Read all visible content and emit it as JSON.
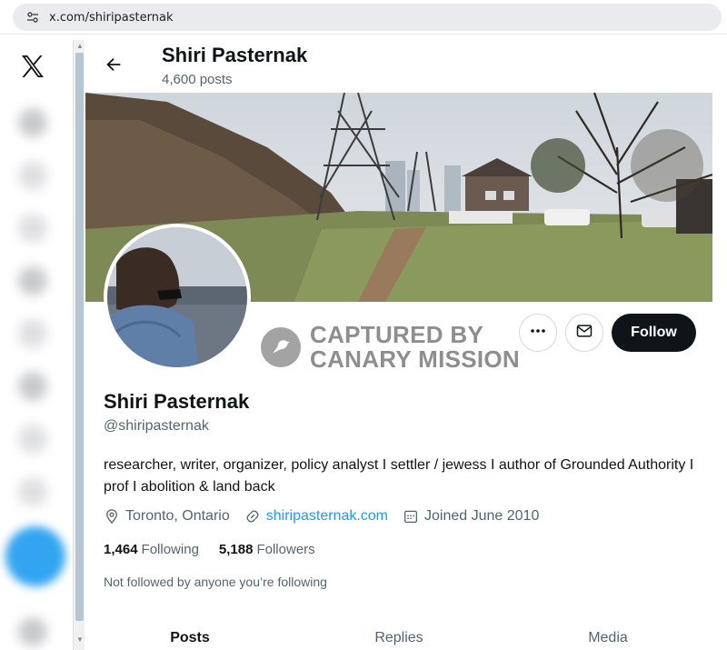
{
  "browser": {
    "url": "x.com/shiripasternak"
  },
  "header": {
    "name": "Shiri Pasternak",
    "posts_count": "4,600 posts"
  },
  "watermark": {
    "line1": "CAPTURED BY",
    "line2": "CANARY MISSION"
  },
  "actions": {
    "follow_label": "Follow"
  },
  "profile": {
    "display_name": "Shiri Pasternak",
    "handle": "@shiripasternak",
    "bio": "researcher, writer, organizer, policy analyst I settler / jewess I author of Grounded Authority I prof I abolition & land back",
    "location": "Toronto, Ontario",
    "website": "shiripasternak.com",
    "joined": "Joined June 2010",
    "following_count": "1,464",
    "following_label": "Following",
    "followers_count": "5,188",
    "followers_label": "Followers",
    "not_followed_note": "Not followed by anyone you’re following"
  },
  "tabs": [
    {
      "label": "Posts"
    },
    {
      "label": "Replies"
    },
    {
      "label": "Media"
    }
  ],
  "colors": {
    "accent": "#1d9bf0",
    "follow_bg": "#0f1419",
    "secondary_text": "#536471"
  },
  "icons": [
    "tune-icon",
    "x-logo-icon",
    "back-arrow-icon",
    "more-icon",
    "mail-icon",
    "location-icon",
    "link-icon",
    "calendar-icon",
    "bird-icon"
  ]
}
